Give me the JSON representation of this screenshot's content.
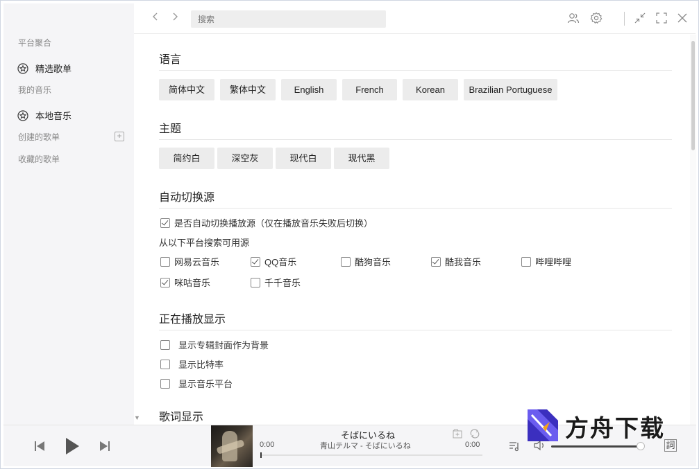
{
  "sidebar": {
    "group_platform": "平台聚合",
    "featured_playlists": "精选歌单",
    "group_my_music": "我的音乐",
    "local_music": "本地音乐",
    "created_playlists": "创建的歌单",
    "collected_playlists": "收藏的歌单"
  },
  "topbar": {
    "back": "‹",
    "forward": "›",
    "search_placeholder": "搜索"
  },
  "settings": {
    "language": {
      "title": "语言",
      "options": [
        "简体中文",
        "繁体中文",
        "English",
        "French",
        "Korean",
        "Brazilian Portuguese"
      ]
    },
    "theme": {
      "title": "主题",
      "options": [
        "简约白",
        "深空灰",
        "现代白",
        "现代黑"
      ]
    },
    "auto_source": {
      "title": "自动切换源",
      "auto_switch_label": "是否自动切换播放源（仅在播放音乐失败后切换）",
      "auto_switch_checked": true,
      "sources_label": "从以下平台搜索可用源",
      "sources": [
        {
          "label": "网易云音乐",
          "checked": false
        },
        {
          "label": "QQ音乐",
          "checked": true
        },
        {
          "label": "酷狗音乐",
          "checked": false
        },
        {
          "label": "酷我音乐",
          "checked": true
        },
        {
          "label": "哔哩哔哩",
          "checked": false
        },
        {
          "label": "咪咕音乐",
          "checked": true
        },
        {
          "label": "千千音乐",
          "checked": false
        }
      ]
    },
    "now_playing": {
      "title": "正在播放显示",
      "options": [
        {
          "label": "显示专辑封面作为背景",
          "checked": false
        },
        {
          "label": "显示比特率",
          "checked": false
        },
        {
          "label": "显示音乐平台",
          "checked": false
        }
      ]
    },
    "lyrics": {
      "title": "歌词显示"
    }
  },
  "player": {
    "song_title": "そばにいるね",
    "song_artist": "青山テルマ - そばにいるね",
    "time_current": "0:00",
    "time_total": "0:00",
    "progress": 0,
    "volume": 0.95,
    "lyrics_button": "詞"
  },
  "watermark": {
    "text": "方舟下载"
  },
  "colors": {
    "sidebar_bg": "#f5f5f7",
    "button_bg": "#ececec",
    "text_primary": "#222222",
    "text_secondary": "#888888"
  }
}
